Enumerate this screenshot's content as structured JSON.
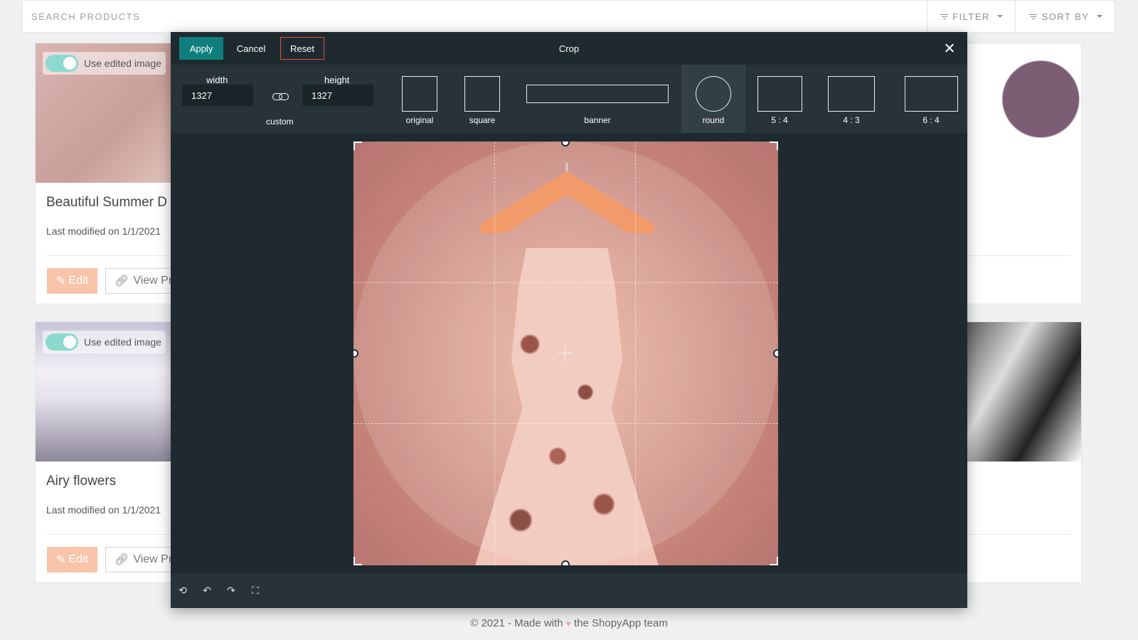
{
  "search": {
    "placeholder": "SEARCH PRODUCTS"
  },
  "toolbar_top": {
    "filter_label": "FILTER",
    "sort_label": "SORT BY"
  },
  "cards": [
    {
      "title": "Beautiful Summer D",
      "date": "Last modified on 1/1/2021",
      "toggle_label": "Use edited image",
      "edit_label": "Edit",
      "view_label": "View Pr"
    },
    {
      "title": "Airy flowers",
      "date": "Last modified on 1/1/2021",
      "toggle_label": "Use edited image",
      "edit_label": "Edit",
      "view_label": "View Pr"
    }
  ],
  "footer": {
    "left": "© 2021 - Made with",
    "right": "the ShopyApp team"
  },
  "modal": {
    "apply": "Apply",
    "cancel": "Cancel",
    "reset": "Reset",
    "title": "Crop",
    "width_label": "width",
    "height_label": "height",
    "width_value": "1327",
    "height_value": "1327",
    "custom_label": "custom",
    "presets": [
      "original",
      "square",
      "banner",
      "round",
      "5 : 4",
      "4 : 3",
      "6 : 4"
    ],
    "active_preset": "round"
  },
  "colors": {
    "accent": "#0e7f7c",
    "reset_border": "#e0522f",
    "modal_bg": "#1f2a30",
    "edit_btn": "#f8c4aa",
    "toggle": "#8bd9cf"
  }
}
